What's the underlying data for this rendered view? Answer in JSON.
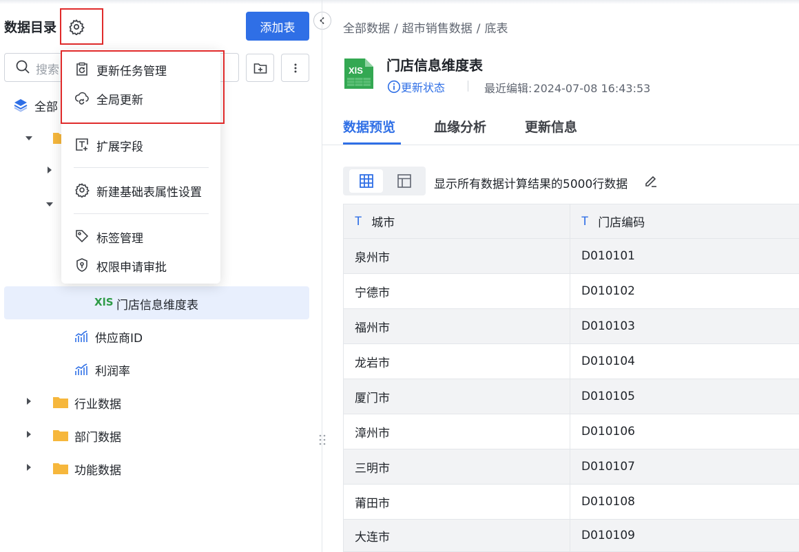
{
  "sidebar": {
    "title": "数据目录",
    "add_table_label": "添加表",
    "search_placeholder": "搜索",
    "tree": {
      "all_label": "全部",
      "selected_item": "门店信息维度表",
      "metric_items": [
        "供应商ID",
        "利润率"
      ],
      "folders": [
        "行业数据",
        "部门数据",
        "功能数据"
      ]
    }
  },
  "settings_menu": {
    "items": [
      "更新任务管理",
      "全局更新",
      "扩展字段",
      "新建基础表属性设置",
      "标签管理",
      "权限申请审批"
    ]
  },
  "breadcrumb": [
    "全部数据",
    "超市销售数据",
    "底表"
  ],
  "detail": {
    "file_icon_text": "XlS",
    "title": "门店信息维度表",
    "status_link": "更新状态",
    "last_edit_label": "最近编辑:",
    "last_edit_time": "2024-07-08 16:43:53",
    "tabs": [
      "数据预览",
      "血缘分析",
      "更新信息"
    ],
    "active_tab": "数据预览",
    "preview_text": "显示所有数据计算结果的5000行数据"
  },
  "table": {
    "columns": [
      "城市",
      "门店编码"
    ],
    "column_type_icon": "T",
    "rows": [
      [
        "泉州市",
        "D010101"
      ],
      [
        "宁德市",
        "D010102"
      ],
      [
        "福州市",
        "D010103"
      ],
      [
        "龙岩市",
        "D010104"
      ],
      [
        "厦门市",
        "D010105"
      ],
      [
        "漳州市",
        "D010106"
      ],
      [
        "三明市",
        "D010107"
      ],
      [
        "莆田市",
        "D010108"
      ],
      [
        "大连市",
        "D010109"
      ]
    ]
  },
  "colors": {
    "primary": "#2f6fe6",
    "highlight_box": "#e02a2a",
    "selected_row_bg": "#e8effd",
    "xls_green": "#2e9b47"
  }
}
